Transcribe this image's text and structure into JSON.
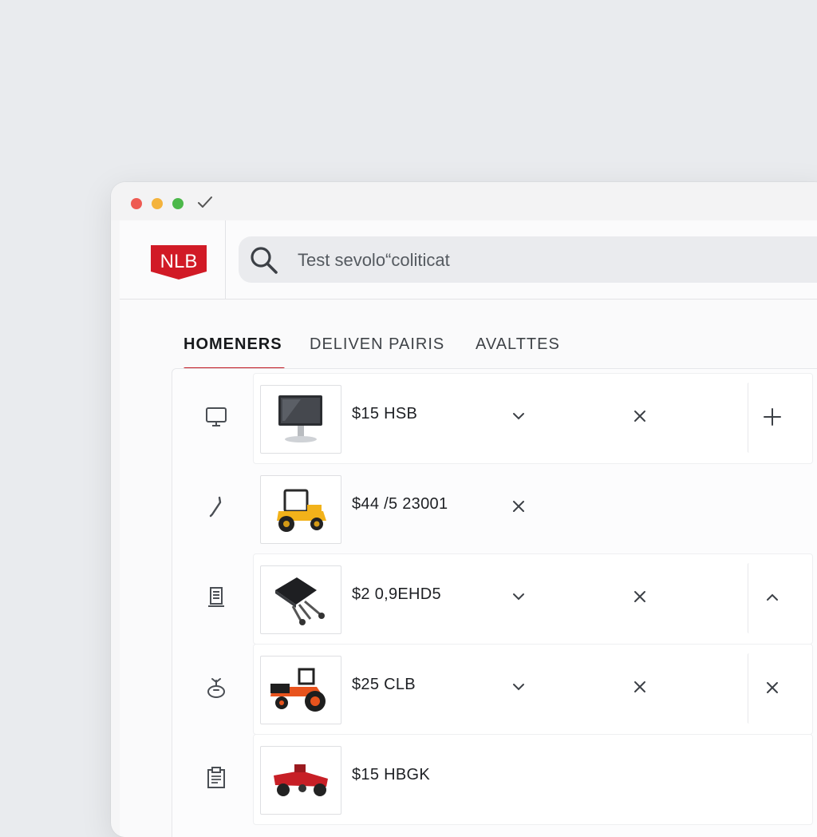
{
  "header": {
    "logo_text": "NLB",
    "search_value": "Test sevolo“coliticat"
  },
  "tabs": [
    {
      "label": "HOMENERS"
    },
    {
      "label": "DELIVEN PAIRIS"
    },
    {
      "label": "AVALTTES"
    }
  ],
  "rows": [
    {
      "icon": "monitor-icon",
      "thumb": "computer-monitor-image",
      "price": "$15 HSB"
    },
    {
      "icon": "pen-icon",
      "thumb": "yellow-tractor-image",
      "price": "$44 /5 23001"
    },
    {
      "icon": "document-icon",
      "thumb": "black-equipment-image",
      "price": "$2 0,9EHD5"
    },
    {
      "icon": "plant-icon",
      "thumb": "orange-tractor-image",
      "price": "$25 CLB"
    },
    {
      "icon": "clipboard-icon",
      "thumb": "red-vehicle-image",
      "price": "$15 HBGK"
    }
  ],
  "colors": {
    "accent": "#c0141f",
    "logo_red": "#d11a26"
  }
}
